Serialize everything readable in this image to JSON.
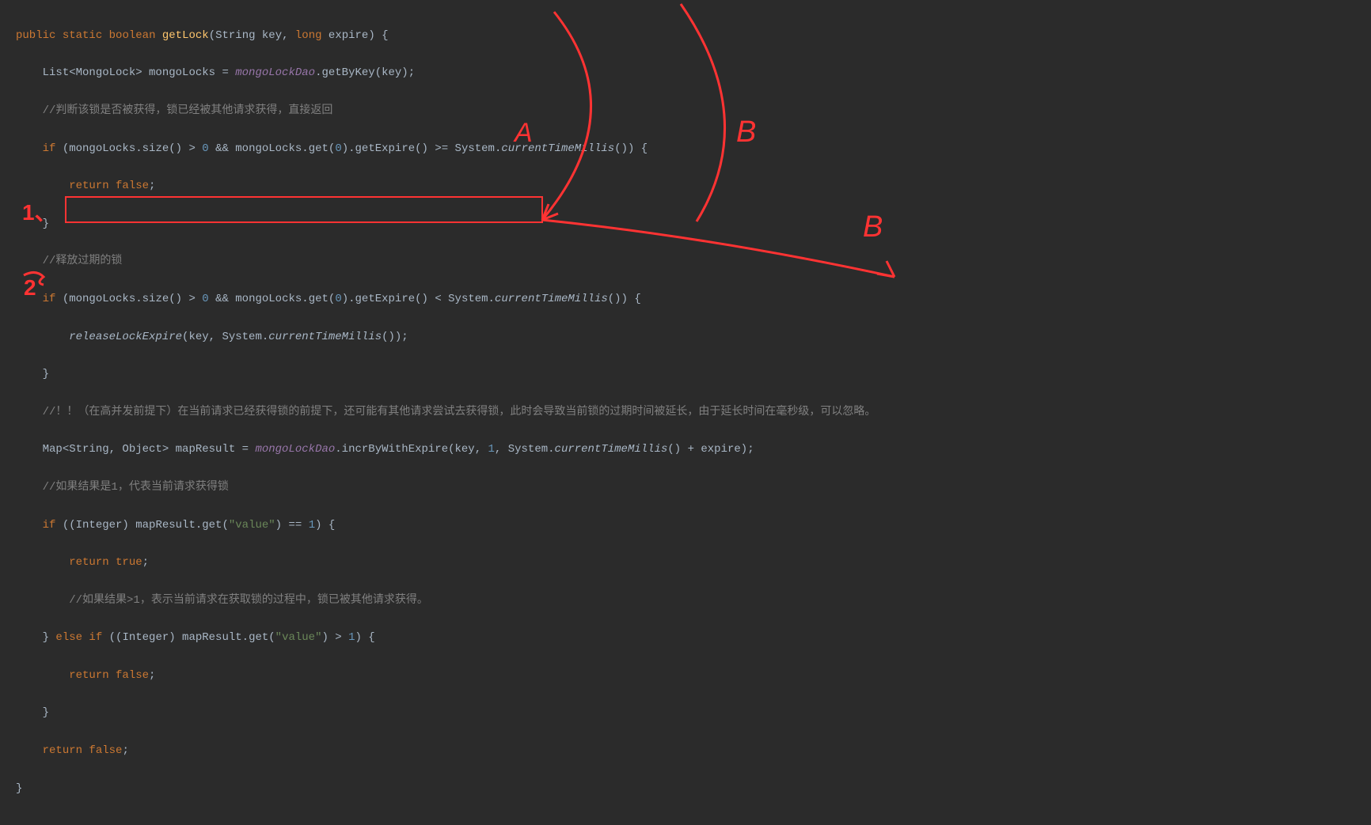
{
  "code": {
    "l1_kw1": "public",
    "l1_kw2": "static",
    "l1_kw3": "boolean",
    "l1_method": "getLock",
    "l1_params": "(String key, ",
    "l1_kw4": "long",
    "l1_params2": " expire) {",
    "l2_a": "List<MongoLock> mongoLocks = ",
    "l2_b": "mongoLockDao",
    "l2_c": ".getByKey(key);",
    "l3": "//判断该锁是否被获得，锁已经被其他请求获得，直接返回",
    "l4_a": "if",
    "l4_b": " (mongoLocks.size() > ",
    "l4_c": "0",
    "l4_d": " && mongoLocks.get(",
    "l4_e": "0",
    "l4_f": ").getExpire() >= System.",
    "l4_g": "currentTimeMillis",
    "l4_h": "()) {",
    "l5_a": "return false",
    "l5_b": ";",
    "l6": "}",
    "l7": "//释放过期的锁",
    "l8_a": "if",
    "l8_b": " (mongoLocks.size() > ",
    "l8_c": "0",
    "l8_d": " && mongoLocks.get(",
    "l8_e": "0",
    "l8_f": ").getExpire() < System.",
    "l8_g": "currentTimeMillis",
    "l8_h": "()) {",
    "l9_a": "releaseLockExpire",
    "l9_b": "(key, System.",
    "l9_c": "currentTimeMillis",
    "l9_d": "());",
    "l10": "}",
    "l11": "//！！（在高并发前提下）在当前请求已经获得锁的前提下，还可能有其他请求尝试去获得锁，此时会导致当前锁的过期时间被延长，由于延长时间在毫秒级，可以忽略。",
    "l12_a": "Map<String, Object> mapResult = ",
    "l12_b": "mongoLockDao",
    "l12_c": ".incrByWithExpire(key, ",
    "l12_d": "1",
    "l12_e": ", System.",
    "l12_f": "currentTimeMillis",
    "l12_g": "() + expire);",
    "l13": "//如果结果是1，代表当前请求获得锁",
    "l14_a": "if",
    "l14_b": " ((Integer) mapResult.get(",
    "l14_c": "\"value\"",
    "l14_d": ") == ",
    "l14_e": "1",
    "l14_f": ") {",
    "l15_a": "return true",
    "l15_b": ";",
    "l16": "//如果结果>1，表示当前请求在获取锁的过程中，锁已被其他请求获得。",
    "l17_a": "} ",
    "l17_b": "else if",
    "l17_c": " ((Integer) mapResult.get(",
    "l17_d": "\"value\"",
    "l17_e": ") > ",
    "l17_f": "1",
    "l17_g": ") {",
    "l18_a": "return false",
    "l18_b": ";",
    "l19": "}",
    "l20_a": "return false",
    "l20_b": ";",
    "l21": "}"
  },
  "annotations": {
    "label_a": "A",
    "label_b1": "B",
    "label_b2": "B",
    "num1": "1、",
    "num2": "2"
  }
}
